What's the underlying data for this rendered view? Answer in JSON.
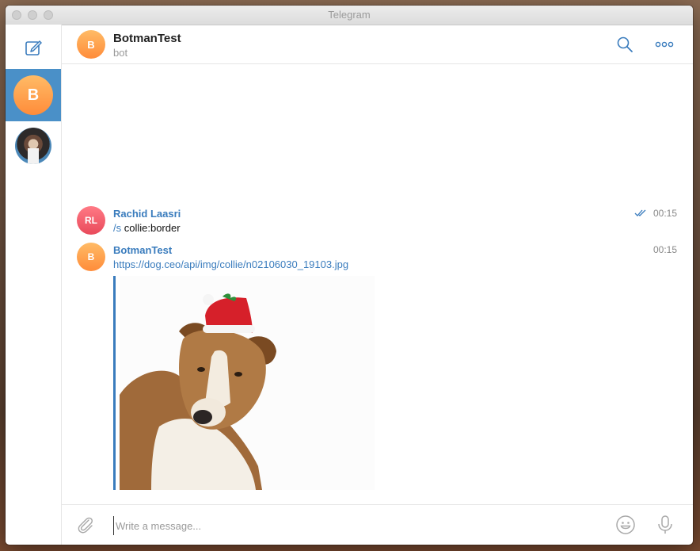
{
  "window": {
    "title": "Telegram"
  },
  "sidebar": {
    "chats": [
      {
        "initial": "B",
        "name": "BotmanTest",
        "active": true
      },
      {
        "initial": "",
        "name": "photo-contact",
        "active": false
      }
    ]
  },
  "header": {
    "initial": "B",
    "title": "BotmanTest",
    "subtitle": "bot"
  },
  "messages": [
    {
      "initials": "RL",
      "sender": "Rachid Laasri",
      "command": "/s",
      "text": " collie:border",
      "time": "00:15",
      "read": true
    },
    {
      "initials": "B",
      "sender": "BotmanTest",
      "link": "https://dog.ceo/api/img/collie/n02106030_19103.jpg",
      "time": "00:15"
    }
  ],
  "composer": {
    "placeholder": "Write a message..."
  },
  "colors": {
    "accent": "#3a7cbd",
    "active_chat": "#4a90c8",
    "bot_avatar": "#ff9a45",
    "user_avatar": "#f0586a"
  }
}
